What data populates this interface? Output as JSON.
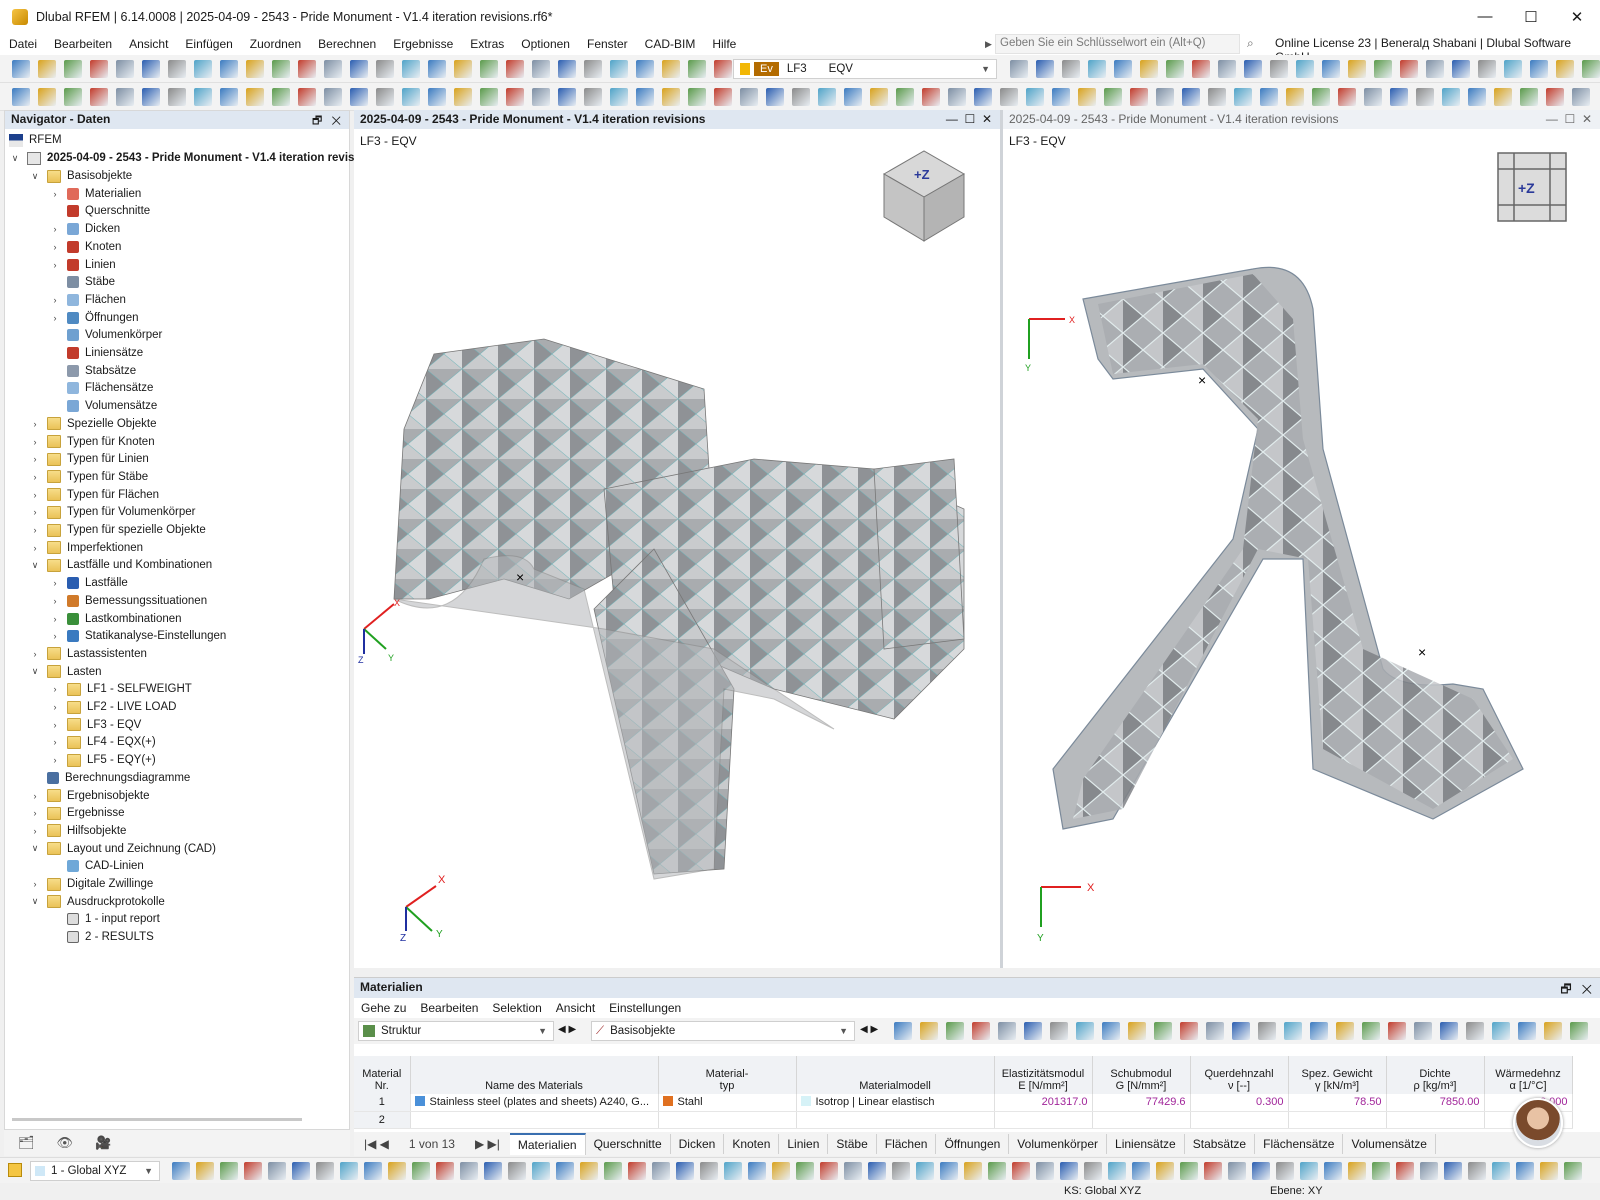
{
  "window": {
    "title": "Dlubal RFEM | 6.14.0008 | 2025-04-09 - 2543 - Pride Monument - V1.4 iteration revisions.rf6*"
  },
  "menu": [
    "Datei",
    "Bearbeiten",
    "Ansicht",
    "Einfügen",
    "Zuordnen",
    "Berechnen",
    "Ergebnisse",
    "Extras",
    "Optionen",
    "Fenster",
    "CAD-BIM",
    "Hilfe"
  ],
  "search": {
    "placeholder": "Geben Sie ein Schlüsselwort ein (Alt+Q)"
  },
  "license": "Online License 23 | Beneralд Shabani | Dlubal Software GmbH",
  "loadcase": {
    "tag": "Ev",
    "code": "LF3",
    "name": "EQV"
  },
  "navigator": {
    "title": "Navigator - Daten",
    "root": "RFEM",
    "project": "2025-04-09 - 2543 - Pride Monument - V1.4 iteration revisi",
    "items": [
      {
        "label": "Basisobjekte",
        "level": 1,
        "open": true,
        "icon": "folder"
      },
      {
        "label": "Materialien",
        "level": 2,
        "tg": true,
        "icon": "materials-icon"
      },
      {
        "label": "Querschnitte",
        "level": 2,
        "icon": "cross-section-icon"
      },
      {
        "label": "Dicken",
        "level": 2,
        "tg": true,
        "icon": "thickness-icon"
      },
      {
        "label": "Knoten",
        "level": 2,
        "tg": true,
        "icon": "node-icon"
      },
      {
        "label": "Linien",
        "level": 2,
        "tg": true,
        "icon": "line-icon"
      },
      {
        "label": "Stäbe",
        "level": 2,
        "icon": "member-icon"
      },
      {
        "label": "Flächen",
        "level": 2,
        "tg": true,
        "icon": "surface-icon"
      },
      {
        "label": "Öffnungen",
        "level": 2,
        "tg": true,
        "icon": "opening-icon"
      },
      {
        "label": "Volumenkörper",
        "level": 2,
        "icon": "solid-icon"
      },
      {
        "label": "Liniensätze",
        "level": 2,
        "icon": "lineset-icon"
      },
      {
        "label": "Stabsätze",
        "level": 2,
        "icon": "memberset-icon"
      },
      {
        "label": "Flächensätze",
        "level": 2,
        "icon": "surfaceset-icon"
      },
      {
        "label": "Volumensätze",
        "level": 2,
        "icon": "solidset-icon"
      },
      {
        "label": "Spezielle Objekte",
        "level": 1,
        "tg": true,
        "icon": "folder"
      },
      {
        "label": "Typen für Knoten",
        "level": 1,
        "tg": true,
        "icon": "folder"
      },
      {
        "label": "Typen für Linien",
        "level": 1,
        "tg": true,
        "icon": "folder"
      },
      {
        "label": "Typen für Stäbe",
        "level": 1,
        "tg": true,
        "icon": "folder"
      },
      {
        "label": "Typen für Flächen",
        "level": 1,
        "tg": true,
        "icon": "folder"
      },
      {
        "label": "Typen für Volumenkörper",
        "level": 1,
        "tg": true,
        "icon": "folder"
      },
      {
        "label": "Typen für spezielle Objekte",
        "level": 1,
        "tg": true,
        "icon": "folder"
      },
      {
        "label": "Imperfektionen",
        "level": 1,
        "tg": true,
        "icon": "folder"
      },
      {
        "label": "Lastfälle und Kombinationen",
        "level": 1,
        "open": true,
        "icon": "folder"
      },
      {
        "label": "Lastfälle",
        "level": 2,
        "tg": true,
        "icon": "loadcase-icon"
      },
      {
        "label": "Bemessungssituationen",
        "level": 2,
        "tg": true,
        "icon": "design-situation-icon"
      },
      {
        "label": "Lastkombinationen",
        "level": 2,
        "tg": true,
        "icon": "load-combination-icon"
      },
      {
        "label": "Statikanalyse-Einstellungen",
        "level": 2,
        "tg": true,
        "icon": "analysis-settings-icon"
      },
      {
        "label": "Lastassistenten",
        "level": 1,
        "tg": true,
        "icon": "folder"
      },
      {
        "label": "Lasten",
        "level": 1,
        "open": true,
        "icon": "folder"
      },
      {
        "label": "LF1 - SELFWEIGHT",
        "level": 2,
        "tg": true,
        "icon": "folder"
      },
      {
        "label": "LF2 - LIVE LOAD",
        "level": 2,
        "tg": true,
        "icon": "folder"
      },
      {
        "label": "LF3 - EQV",
        "level": 2,
        "tg": true,
        "icon": "folder"
      },
      {
        "label": "LF4 - EQX(+)",
        "level": 2,
        "tg": true,
        "icon": "folder"
      },
      {
        "label": "LF5 - EQY(+)",
        "level": 2,
        "tg": true,
        "icon": "folder"
      },
      {
        "label": "Berechnungsdiagramme",
        "level": 1,
        "icon": "diagram-icon"
      },
      {
        "label": "Ergebnisobjekte",
        "level": 1,
        "tg": true,
        "icon": "folder"
      },
      {
        "label": "Ergebnisse",
        "level": 1,
        "tg": true,
        "icon": "folder"
      },
      {
        "label": "Hilfsobjekte",
        "level": 1,
        "tg": true,
        "icon": "folder"
      },
      {
        "label": "Layout und Zeichnung (CAD)",
        "level": 1,
        "open": true,
        "icon": "folder"
      },
      {
        "label": "CAD-Linien",
        "level": 2,
        "icon": "cad-line-icon"
      },
      {
        "label": "Digitale Zwillinge",
        "level": 1,
        "tg": true,
        "icon": "folder"
      },
      {
        "label": "Ausdruckprotokolle",
        "level": 1,
        "open": true,
        "icon": "folder"
      },
      {
        "label": "1 - input report",
        "level": 2,
        "icon": "report-icon"
      },
      {
        "label": "2 - RESULTS",
        "level": 2,
        "icon": "report-icon"
      }
    ]
  },
  "viewport1": {
    "title": "2025-04-09 - 2543 - Pride Monument - V1.4 iteration revisions",
    "label": "LF3 - EQV"
  },
  "viewport2": {
    "title": "2025-04-09 - 2543 - Pride Monument - V1.4 iteration revisions",
    "label": "LF3 - EQV",
    "cube_label": "+Z"
  },
  "axes": {
    "x": "X",
    "y": "Y",
    "z": "Z"
  },
  "panel": {
    "title": "Materialien",
    "menu": [
      "Gehe zu",
      "Bearbeiten",
      "Selektion",
      "Ansicht",
      "Einstellungen"
    ],
    "combo1": "Struktur",
    "combo2": "Basisobjekte",
    "columns": [
      [
        "Material",
        "Nr."
      ],
      [
        "",
        "Name des Materials"
      ],
      [
        "Material-",
        "typ"
      ],
      [
        "",
        "Materialmodell"
      ],
      [
        "Elastizitätsmodul",
        "E [N/mm²]"
      ],
      [
        "Schubmodul",
        "G [N/mm²]"
      ],
      [
        "Querdehnzahl",
        "ν [--]"
      ],
      [
        "Spez. Gewicht",
        "γ [kN/m³]"
      ],
      [
        "Dichte",
        "ρ [kg/m³]"
      ],
      [
        "Wärmedehnz",
        "α [1/°C]"
      ]
    ],
    "rows": [
      {
        "nr": "1",
        "name": "Stainless steel (plates and sheets) A240, G...",
        "type": "Stahl",
        "model": "Isotrop | Linear elastisch",
        "E": "201317.0",
        "G": "77429.6",
        "nu": "0.300",
        "gamma": "78.50",
        "rho": "7850.00",
        "alpha": "0.000"
      },
      {
        "nr": "2",
        "name": "",
        "type": "",
        "model": "",
        "E": "",
        "G": "",
        "nu": "",
        "gamma": "",
        "rho": "",
        "alpha": ""
      }
    ],
    "pager": "1 von 13",
    "tabs": [
      "Materialien",
      "Querschnitte",
      "Dicken",
      "Knoten",
      "Linien",
      "Stäbe",
      "Flächen",
      "Öffnungen",
      "Volumenkörper",
      "Liniensätze",
      "Stabsätze",
      "Flächensätze",
      "Volumensätze"
    ]
  },
  "bottom": {
    "coord_system": "1 - Global XYZ"
  },
  "status": {
    "ks": "KS: Global XYZ",
    "plane": "Ebene: XY"
  }
}
